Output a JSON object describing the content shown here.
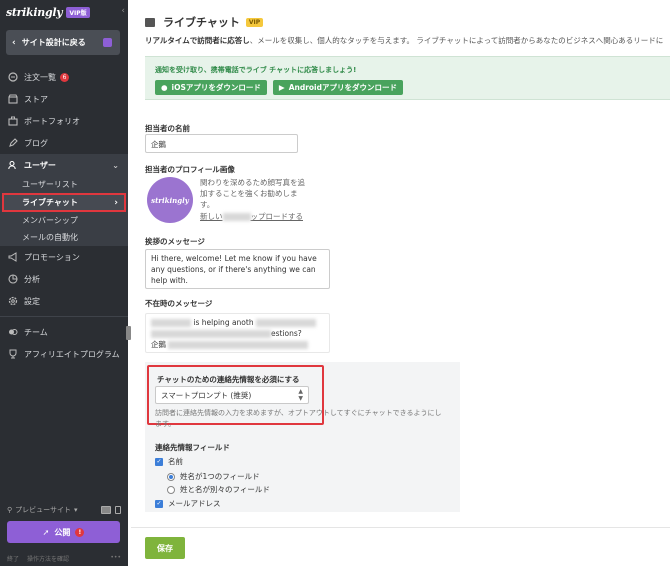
{
  "sidebar": {
    "logo": "strikingly",
    "vip": "VIP版",
    "back_label": "サイト設計に戻る",
    "items": [
      {
        "label": "注文一覧",
        "count": "6",
        "icon": "cart-icon"
      },
      {
        "label": "ストア",
        "icon": "store-icon"
      },
      {
        "label": "ポートフォリオ",
        "icon": "briefcase-icon"
      },
      {
        "label": "ブログ",
        "icon": "pen-icon"
      },
      {
        "label": "ユーザー",
        "icon": "users-icon"
      }
    ],
    "sub_items": [
      {
        "label": "ユーザーリスト"
      },
      {
        "label": "ライブチャット"
      },
      {
        "label": "メンバーシップ"
      },
      {
        "label": "メールの自動化"
      }
    ],
    "items2": [
      {
        "label": "プロモーション",
        "icon": "megaphone-icon"
      },
      {
        "label": "分析",
        "icon": "chart-icon"
      },
      {
        "label": "設定",
        "icon": "gear-icon"
      },
      {
        "label": "チーム",
        "icon": "team-icon"
      },
      {
        "label": "アフィリエイトプログラム",
        "icon": "trophy-icon"
      }
    ],
    "preview_label": "プレビューサイト",
    "publish_label": "公開",
    "footer_left": "終了",
    "footer_mid": "操作方法を確認"
  },
  "main": {
    "title": "ライブチャット",
    "title_badge": "VIP",
    "desc_bold": "リアルタイムで訪問者に応答し",
    "desc_rest": "、メールを収集し、個人的なタッチを与えます。 ライブチャットによって訪問者からあなたのビジネスへ関心あるリードに",
    "notice": "通知を受け取り、携帯電話でライブ チャットに応答しましょう!",
    "ios_btn": "iOSアプリをダウンロード",
    "android_btn": "Androidアプリをダウンロード",
    "agent_name_label": "担当者の名前",
    "agent_name_value": "企鵝",
    "profile_label": "担当者のプロフィール画像",
    "avatar_text": "strikingly",
    "profile_desc": "関わりを深めるため顔写真を追加することを強くお勧めします。",
    "upload_prefix": "新しい",
    "upload_suffix": "ップロードする",
    "greeting_label": "挨拶のメッセージ",
    "greeting_value": "Hi there, welcome! Let me know if you have any questions, or if there's anything we can help with.",
    "away_label": "不在時のメッセージ",
    "away_fragment_1": "is helping anoth",
    "away_fragment_2": "estions?",
    "away_sign": "企鵝",
    "required_label": "チャットのための連絡先情報を必須にする",
    "required_select": "スマートプロンプト (推奨)",
    "help_text": "訪問者に連絡先情報の入力を求めますが、オプトアウトしてすぐにチャットできるようにします。",
    "contact_fields_label": "連絡先情報フィールド",
    "field_name": "名前",
    "radio_single": "姓名が1つのフィールド",
    "radio_split": "姓と名が別々のフィールド",
    "field_email": "メールアドレス",
    "save_label": "保存"
  }
}
